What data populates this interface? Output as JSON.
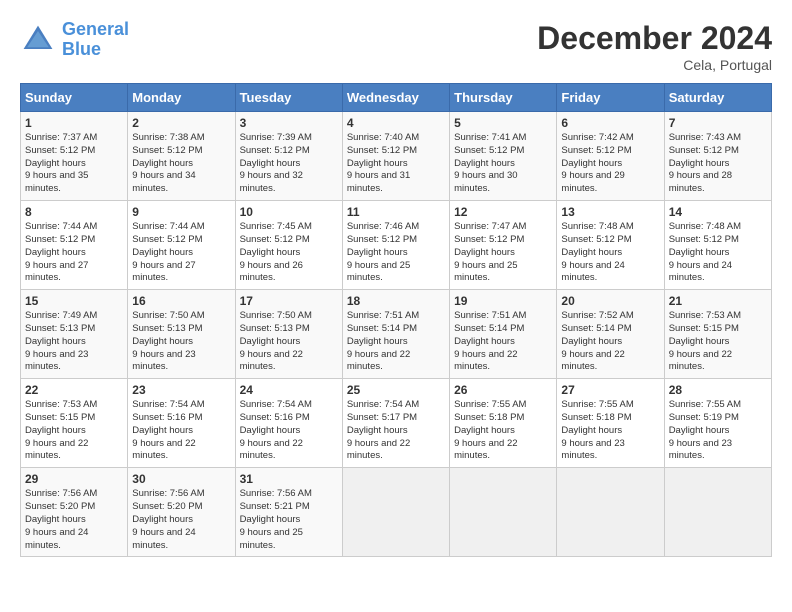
{
  "app": {
    "logo_line1": "General",
    "logo_line2": "Blue"
  },
  "header": {
    "month": "December 2024",
    "location": "Cela, Portugal"
  },
  "columns": [
    "Sunday",
    "Monday",
    "Tuesday",
    "Wednesday",
    "Thursday",
    "Friday",
    "Saturday"
  ],
  "weeks": [
    [
      {
        "day": "1",
        "sunrise": "7:37 AM",
        "sunset": "5:12 PM",
        "daylight": "9 hours and 35 minutes."
      },
      {
        "day": "2",
        "sunrise": "7:38 AM",
        "sunset": "5:12 PM",
        "daylight": "9 hours and 34 minutes."
      },
      {
        "day": "3",
        "sunrise": "7:39 AM",
        "sunset": "5:12 PM",
        "daylight": "9 hours and 32 minutes."
      },
      {
        "day": "4",
        "sunrise": "7:40 AM",
        "sunset": "5:12 PM",
        "daylight": "9 hours and 31 minutes."
      },
      {
        "day": "5",
        "sunrise": "7:41 AM",
        "sunset": "5:12 PM",
        "daylight": "9 hours and 30 minutes."
      },
      {
        "day": "6",
        "sunrise": "7:42 AM",
        "sunset": "5:12 PM",
        "daylight": "9 hours and 29 minutes."
      },
      {
        "day": "7",
        "sunrise": "7:43 AM",
        "sunset": "5:12 PM",
        "daylight": "9 hours and 28 minutes."
      }
    ],
    [
      {
        "day": "8",
        "sunrise": "7:44 AM",
        "sunset": "5:12 PM",
        "daylight": "9 hours and 27 minutes."
      },
      {
        "day": "9",
        "sunrise": "7:44 AM",
        "sunset": "5:12 PM",
        "daylight": "9 hours and 27 minutes."
      },
      {
        "day": "10",
        "sunrise": "7:45 AM",
        "sunset": "5:12 PM",
        "daylight": "9 hours and 26 minutes."
      },
      {
        "day": "11",
        "sunrise": "7:46 AM",
        "sunset": "5:12 PM",
        "daylight": "9 hours and 25 minutes."
      },
      {
        "day": "12",
        "sunrise": "7:47 AM",
        "sunset": "5:12 PM",
        "daylight": "9 hours and 25 minutes."
      },
      {
        "day": "13",
        "sunrise": "7:48 AM",
        "sunset": "5:12 PM",
        "daylight": "9 hours and 24 minutes."
      },
      {
        "day": "14",
        "sunrise": "7:48 AM",
        "sunset": "5:12 PM",
        "daylight": "9 hours and 24 minutes."
      }
    ],
    [
      {
        "day": "15",
        "sunrise": "7:49 AM",
        "sunset": "5:13 PM",
        "daylight": "9 hours and 23 minutes."
      },
      {
        "day": "16",
        "sunrise": "7:50 AM",
        "sunset": "5:13 PM",
        "daylight": "9 hours and 23 minutes."
      },
      {
        "day": "17",
        "sunrise": "7:50 AM",
        "sunset": "5:13 PM",
        "daylight": "9 hours and 22 minutes."
      },
      {
        "day": "18",
        "sunrise": "7:51 AM",
        "sunset": "5:14 PM",
        "daylight": "9 hours and 22 minutes."
      },
      {
        "day": "19",
        "sunrise": "7:51 AM",
        "sunset": "5:14 PM",
        "daylight": "9 hours and 22 minutes."
      },
      {
        "day": "20",
        "sunrise": "7:52 AM",
        "sunset": "5:14 PM",
        "daylight": "9 hours and 22 minutes."
      },
      {
        "day": "21",
        "sunrise": "7:53 AM",
        "sunset": "5:15 PM",
        "daylight": "9 hours and 22 minutes."
      }
    ],
    [
      {
        "day": "22",
        "sunrise": "7:53 AM",
        "sunset": "5:15 PM",
        "daylight": "9 hours and 22 minutes."
      },
      {
        "day": "23",
        "sunrise": "7:54 AM",
        "sunset": "5:16 PM",
        "daylight": "9 hours and 22 minutes."
      },
      {
        "day": "24",
        "sunrise": "7:54 AM",
        "sunset": "5:16 PM",
        "daylight": "9 hours and 22 minutes."
      },
      {
        "day": "25",
        "sunrise": "7:54 AM",
        "sunset": "5:17 PM",
        "daylight": "9 hours and 22 minutes."
      },
      {
        "day": "26",
        "sunrise": "7:55 AM",
        "sunset": "5:18 PM",
        "daylight": "9 hours and 22 minutes."
      },
      {
        "day": "27",
        "sunrise": "7:55 AM",
        "sunset": "5:18 PM",
        "daylight": "9 hours and 23 minutes."
      },
      {
        "day": "28",
        "sunrise": "7:55 AM",
        "sunset": "5:19 PM",
        "daylight": "9 hours and 23 minutes."
      }
    ],
    [
      {
        "day": "29",
        "sunrise": "7:56 AM",
        "sunset": "5:20 PM",
        "daylight": "9 hours and 24 minutes."
      },
      {
        "day": "30",
        "sunrise": "7:56 AM",
        "sunset": "5:20 PM",
        "daylight": "9 hours and 24 minutes."
      },
      {
        "day": "31",
        "sunrise": "7:56 AM",
        "sunset": "5:21 PM",
        "daylight": "9 hours and 25 minutes."
      },
      null,
      null,
      null,
      null
    ]
  ],
  "labels": {
    "sunrise": "Sunrise:",
    "sunset": "Sunset:",
    "daylight": "Daylight hours"
  }
}
